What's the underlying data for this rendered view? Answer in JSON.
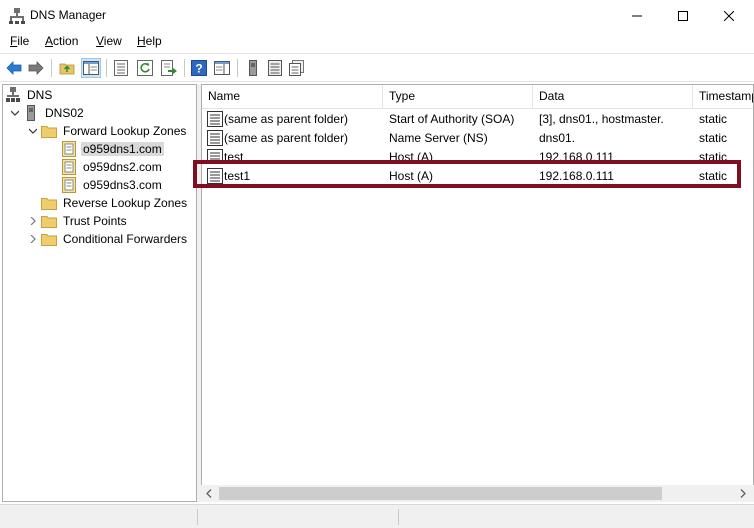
{
  "window": {
    "title": "DNS Manager"
  },
  "menu": {
    "file": {
      "accel": "F",
      "rest": "ile"
    },
    "action": {
      "accel": "A",
      "rest": "ction"
    },
    "view": {
      "accel": "V",
      "rest": "iew"
    },
    "help": {
      "accel": "H",
      "rest": "elp"
    }
  },
  "tree": {
    "root": "DNS",
    "server": "DNS02",
    "forward": "Forward Lookup Zones",
    "zones": [
      "o959dns1.com",
      "o959dns2.com",
      "o959dns3.com"
    ],
    "reverse": "Reverse Lookup Zones",
    "trust": "Trust Points",
    "conditional": "Conditional Forwarders",
    "selected_zone": "o959dns1.com"
  },
  "list": {
    "columns": [
      "Name",
      "Type",
      "Data",
      "Timestamp"
    ],
    "rows": [
      {
        "name": "(same as parent folder)",
        "type": "Start of Authority (SOA)",
        "data": "[3], dns01., hostmaster.",
        "timestamp": "static"
      },
      {
        "name": "(same as parent folder)",
        "type": "Name Server (NS)",
        "data": "dns01.",
        "timestamp": "static"
      },
      {
        "name": "test",
        "type": "Host (A)",
        "data": "192.168.0.111",
        "timestamp": "static"
      },
      {
        "name": "test1",
        "type": "Host (A)",
        "data": "192.168.0.111",
        "timestamp": "static"
      }
    ]
  },
  "colors": {
    "highlight": "#7f0f20",
    "selection": "#d9d9d9",
    "accent": "#2b7bd6"
  }
}
